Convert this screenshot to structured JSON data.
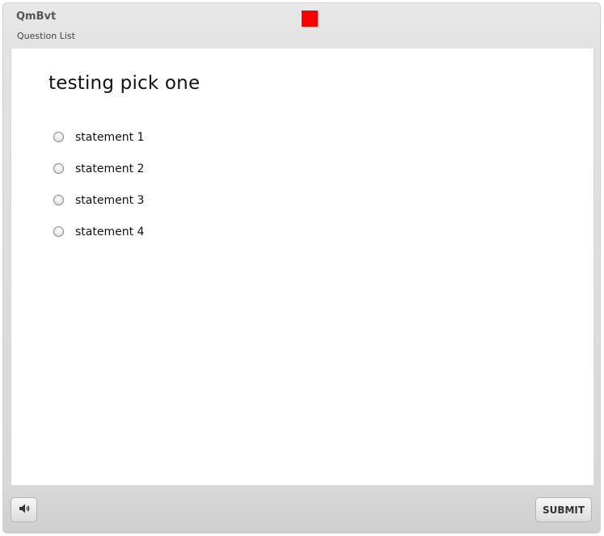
{
  "header": {
    "title": "QmBvt",
    "subtitle": "Question List",
    "status_color": "#ff0000"
  },
  "question": {
    "title": "testing pick one",
    "options": [
      {
        "label": "statement 1",
        "selected": false
      },
      {
        "label": "statement 2",
        "selected": false
      },
      {
        "label": "statement 3",
        "selected": false
      },
      {
        "label": "statement 4",
        "selected": false
      }
    ]
  },
  "footer": {
    "audio_icon": "speaker-icon",
    "submit_label": "SUBMIT"
  }
}
